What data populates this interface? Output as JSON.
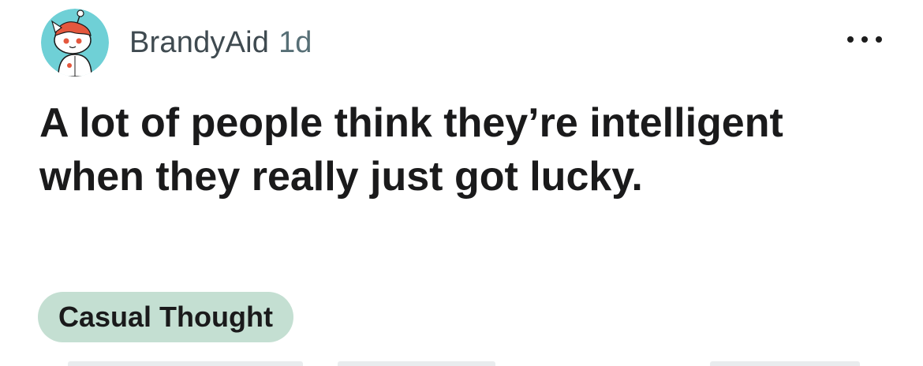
{
  "post": {
    "author": "BrandyAid",
    "age": "1d",
    "title": "A lot of people think they’re intelligent when they really just got lucky.",
    "flair": "Casual Thought"
  },
  "icons": {
    "avatar": "snoo-avatar-icon",
    "more": "more-options-icon"
  },
  "colors": {
    "avatar_bg": "#6fd0d6",
    "flair_bg": "#c4dfd2",
    "username": "#3f4a50",
    "timestamp": "#576f76",
    "title": "#1a1a1b"
  }
}
